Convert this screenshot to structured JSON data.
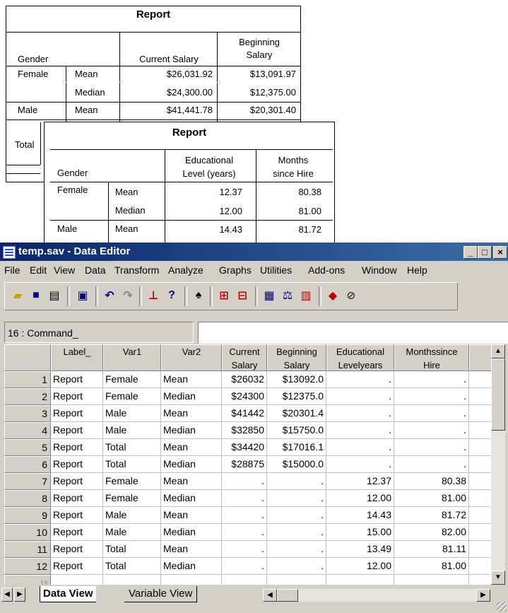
{
  "report1": {
    "title": "Report",
    "col_gender": "Gender",
    "col_current_salary": "Current Salary",
    "col_beginning_salary_line1": "Beginning",
    "col_beginning_salary_line2": "Salary",
    "rows": [
      {
        "gender": "Female",
        "stat": "Mean",
        "current": "$26,031.92",
        "beginning": "$13,091.97"
      },
      {
        "gender": "",
        "stat": "Median",
        "current": "$24,300.00",
        "beginning": "$12,375.00"
      },
      {
        "gender": "Male",
        "stat": "Mean",
        "current": "$41,441.78",
        "beginning": "$20,301.40"
      }
    ],
    "total_label": "Total"
  },
  "report2": {
    "title": "Report",
    "col_gender": "Gender",
    "col_edu_line1": "Educational",
    "col_edu_line2": "Level (years)",
    "col_months_line1": "Months",
    "col_months_line2": "since Hire",
    "rows": [
      {
        "gender": "Female",
        "stat": "Mean",
        "edu": "12.37",
        "months": "80.38"
      },
      {
        "gender": "",
        "stat": "Median",
        "edu": "12.00",
        "months": "81.00"
      },
      {
        "gender": "Male",
        "stat": "Mean",
        "edu": "14.43",
        "months": "81.72"
      }
    ]
  },
  "window": {
    "title": "temp.sav - Data Editor",
    "minimize": "_",
    "maximize": "□",
    "close": "×"
  },
  "menu": [
    "File",
    "Edit",
    "View",
    "Data",
    "Transform",
    "Analyze",
    "Graphs",
    "Utilities",
    "Add-ons",
    "Window",
    "Help"
  ],
  "toolbar_icons": [
    "open-icon",
    "save-icon",
    "print-icon",
    "dialog-recall-icon",
    "undo-icon",
    "redo-icon",
    "goto-chart-icon",
    "variables-icon",
    "find-icon",
    "insert-cases-icon",
    "insert-variable-icon",
    "split-file-icon",
    "weight-cases-icon",
    "select-cases-icon",
    "value-labels-icon",
    "use-sets-icon"
  ],
  "cell_ref": "16 : Command_",
  "columns": [
    {
      "line1": "Label_",
      "line2": ""
    },
    {
      "line1": "Var1",
      "line2": ""
    },
    {
      "line1": "Var2",
      "line2": ""
    },
    {
      "line1": "Current",
      "line2": "Salary"
    },
    {
      "line1": "Beginning",
      "line2": "Salary"
    },
    {
      "line1": "Educational",
      "line2": "Levelyears"
    },
    {
      "line1": "Monthssince",
      "line2": "Hire"
    }
  ],
  "rows": [
    {
      "n": "1",
      "cells": [
        "Report",
        "Female",
        "Mean",
        "$26032",
        "$13092.0",
        ".",
        "."
      ]
    },
    {
      "n": "2",
      "cells": [
        "Report",
        "Female",
        "Median",
        "$24300",
        "$12375.0",
        ".",
        "."
      ]
    },
    {
      "n": "3",
      "cells": [
        "Report",
        "Male",
        "Mean",
        "$41442",
        "$20301.4",
        ".",
        "."
      ]
    },
    {
      "n": "4",
      "cells": [
        "Report",
        "Male",
        "Median",
        "$32850",
        "$15750.0",
        ".",
        "."
      ]
    },
    {
      "n": "5",
      "cells": [
        "Report",
        "Total",
        "Mean",
        "$34420",
        "$17016.1",
        ".",
        "."
      ]
    },
    {
      "n": "6",
      "cells": [
        "Report",
        "Total",
        "Median",
        "$28875",
        "$15000.0",
        ".",
        "."
      ]
    },
    {
      "n": "7",
      "cells": [
        "Report",
        "Female",
        "Mean",
        ".",
        ".",
        "12.37",
        "80.38"
      ]
    },
    {
      "n": "8",
      "cells": [
        "Report",
        "Female",
        "Median",
        ".",
        ".",
        "12.00",
        "81.00"
      ]
    },
    {
      "n": "9",
      "cells": [
        "Report",
        "Male",
        "Mean",
        ".",
        ".",
        "14.43",
        "81.72"
      ]
    },
    {
      "n": "10",
      "cells": [
        "Report",
        "Male",
        "Median",
        ".",
        ".",
        "15.00",
        "82.00"
      ]
    },
    {
      "n": "11",
      "cells": [
        "Report",
        "Total",
        "Mean",
        ".",
        ".",
        "13.49",
        "81.11"
      ]
    },
    {
      "n": "12",
      "cells": [
        "Report",
        "Total",
        "Median",
        ".",
        ".",
        "12.00",
        "81.00"
      ]
    },
    {
      "n": "13",
      "cells": [
        "",
        "",
        "",
        "",
        "",
        "",
        ""
      ]
    }
  ],
  "tabs": {
    "data_view": "Data View",
    "variable_view": "Variable View"
  }
}
